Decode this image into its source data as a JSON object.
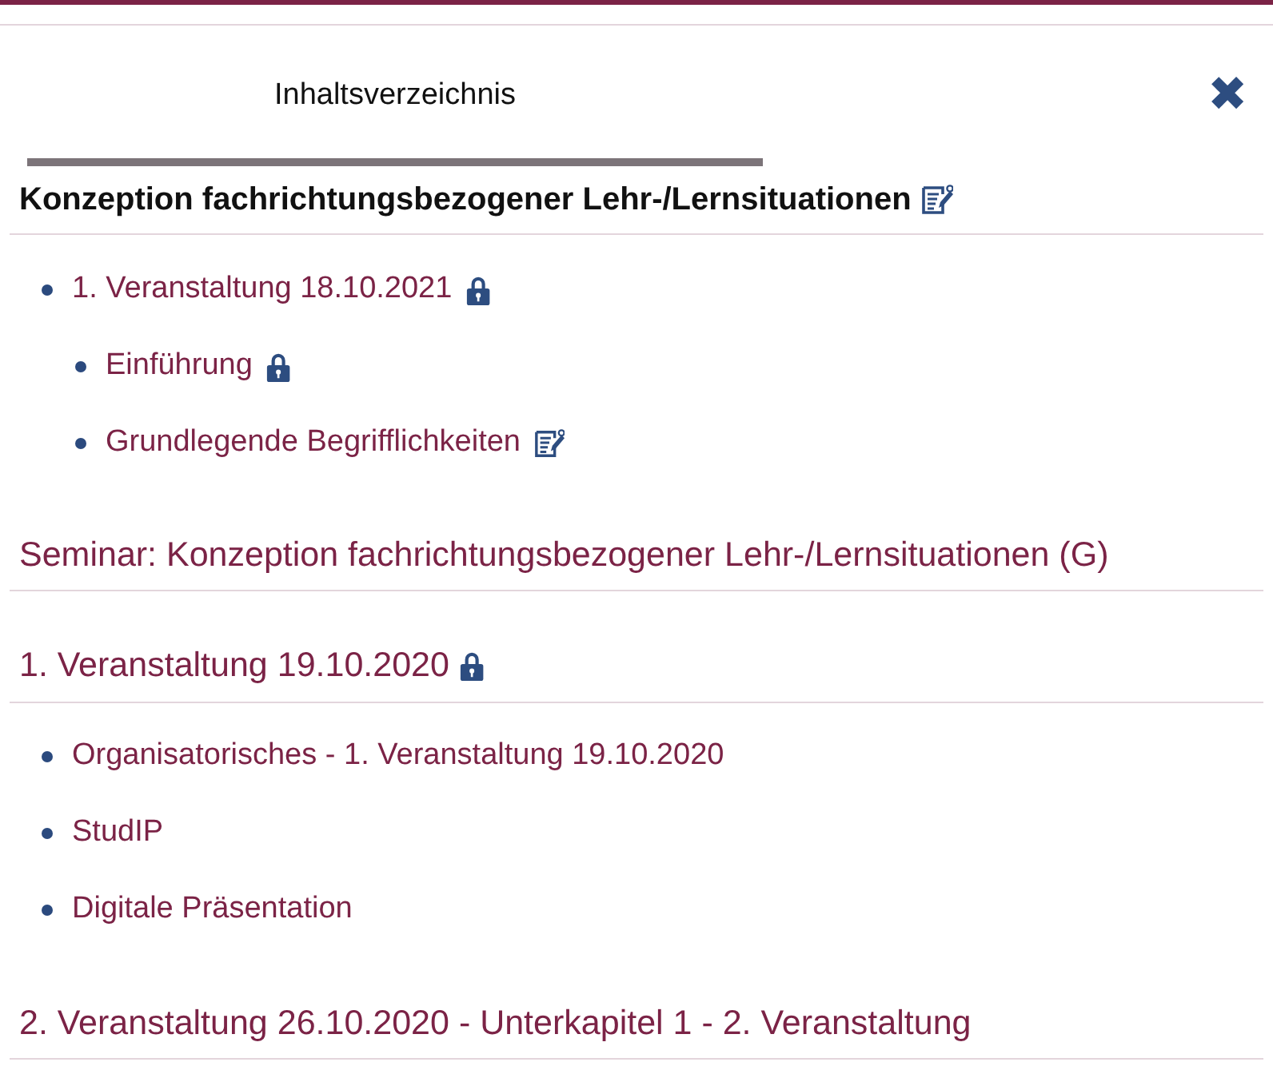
{
  "tabs": [
    {
      "label": "Inhaltsverzeichnis",
      "selected": true
    }
  ],
  "close": {
    "symbol": "✖"
  },
  "sections": [
    {
      "kind": "current",
      "title": "Konzeption fachrichtungsbezogener Lehr-/Lernsituationen",
      "locked": false,
      "editable": true,
      "items": [
        {
          "label": "1. Veranstaltung 18.10.2021",
          "locked": true,
          "editable": false,
          "children": [
            {
              "label": "Einführung",
              "locked": true,
              "editable": false
            },
            {
              "label": "Grundlegende Begrifflichkeiten",
              "locked": false,
              "editable": true
            }
          ]
        }
      ]
    },
    {
      "kind": "link",
      "title": "Seminar: Konzeption fachrichtungsbezogener Lehr-/Lernsituationen (G)",
      "locked": false,
      "editable": false
    },
    {
      "kind": "link",
      "title": "1. Veranstaltung 19.10.2020",
      "locked": true,
      "editable": false,
      "items": [
        {
          "label": "Organisatorisches - 1. Veranstaltung 19.10.2020",
          "locked": false,
          "editable": false
        },
        {
          "label": "StudIP",
          "locked": false,
          "editable": false
        },
        {
          "label": "Digitale Präsentation",
          "locked": false,
          "editable": false
        }
      ]
    },
    {
      "kind": "link",
      "title": "2. Veranstaltung 26.10.2020 - Unterkapitel 1 - 2. Veranstaltung",
      "locked": false,
      "editable": false
    }
  ]
}
